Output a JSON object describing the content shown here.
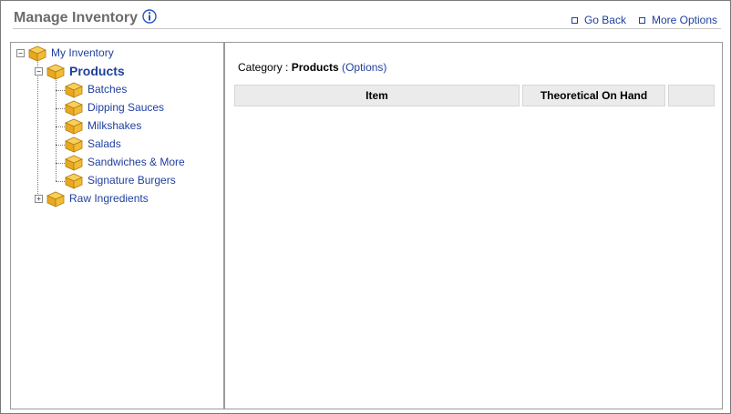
{
  "header": {
    "title": "Manage Inventory",
    "links": {
      "go_back": "Go Back",
      "more_options": "More Options"
    }
  },
  "tree": {
    "root": "My Inventory",
    "products": "Products",
    "children": [
      "Batches",
      "Dipping Sauces",
      "Milkshakes",
      "Salads",
      "Sandwiches & More",
      "Signature Burgers"
    ],
    "raw": "Raw Ingredients"
  },
  "main": {
    "category_label": "Category : ",
    "category_value": "Products",
    "options_open": " (",
    "options_link": "Options",
    "options_close": ")",
    "table": {
      "columns": [
        "Item",
        "Theoretical On Hand",
        ""
      ]
    }
  },
  "colors": {
    "link": "#1f3f9e",
    "title": "#6b6b6b",
    "folder": "#f0b429"
  }
}
